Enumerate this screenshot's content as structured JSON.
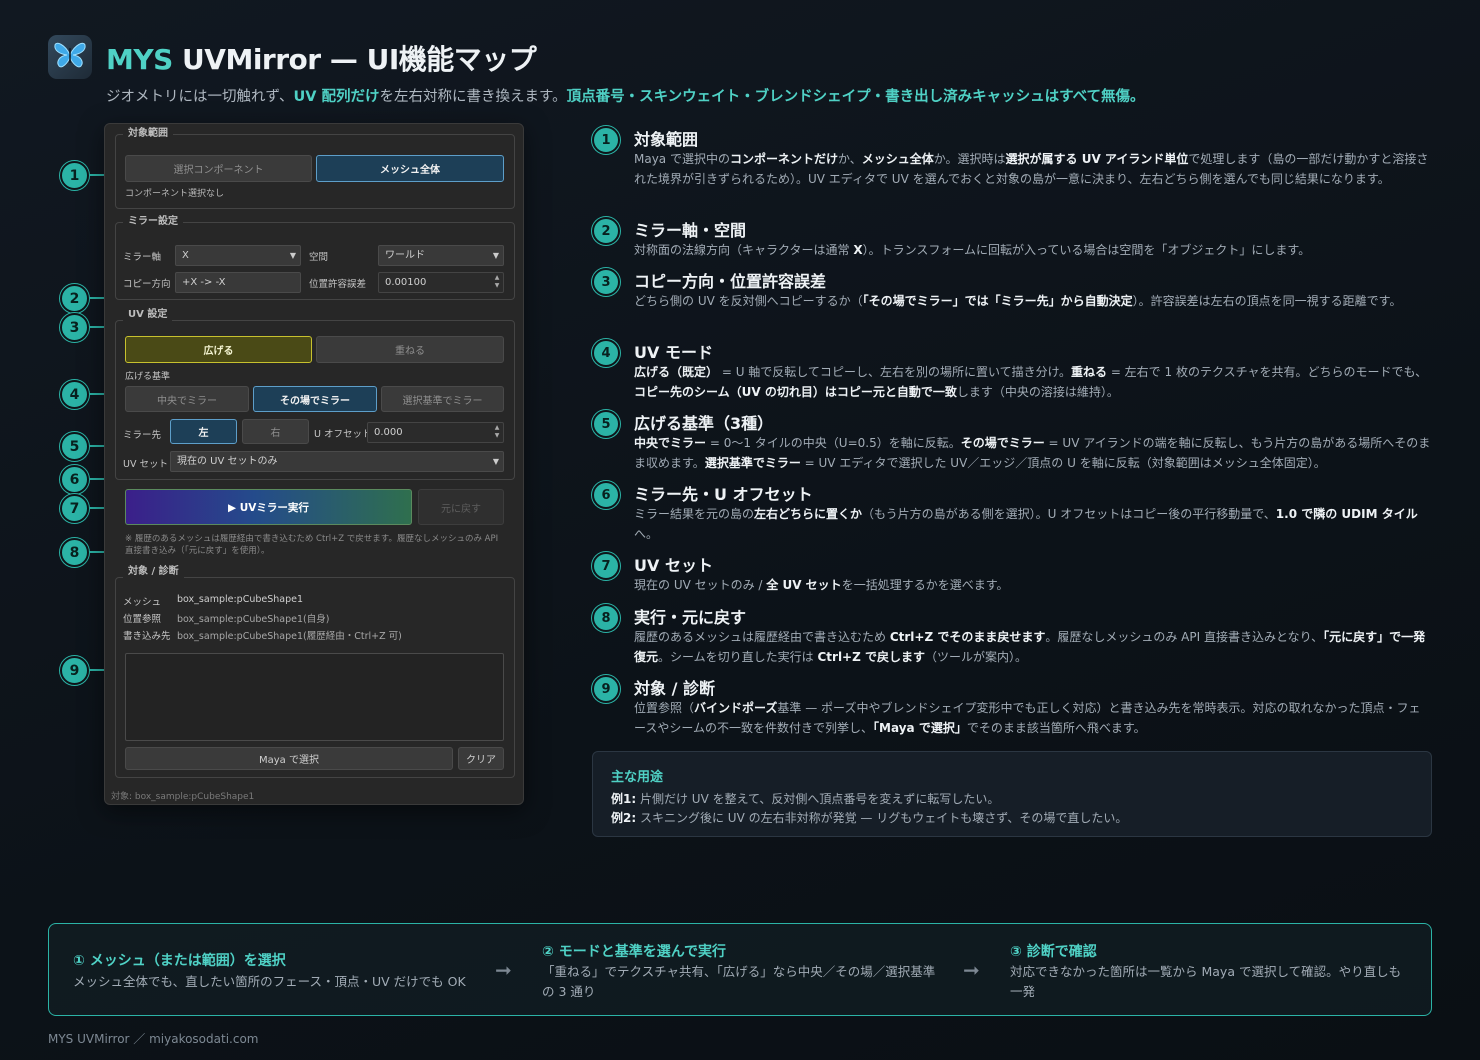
{
  "header": {
    "title_brand": "MYS",
    "title_rest": " UVMirror — UI機能マップ",
    "logo_icon": "butterfly-icon",
    "subtitle_a": "ジオメトリには一切触れず、",
    "subtitle_b": "UV 配列だけ",
    "subtitle_c": "を左右対称に書き換えます。",
    "subtitle_d": "頂点番号・スキンウェイト・ブレンドシェイプ・書き出し済みキャッシュはすべて無傷。"
  },
  "panel": {
    "scope": {
      "group": "対象範囲",
      "btn_components": "選択コンポーネント",
      "btn_mesh": "メッシュ全体",
      "status": "コンポーネント選択なし"
    },
    "mirror": {
      "group": "ミラー設定",
      "axis_label": "ミラー軸",
      "axis_value": "X",
      "space_label": "空間",
      "space_value": "ワールド",
      "dir_label": "コピー方向",
      "dir_value": "+X -> -X",
      "tol_label": "位置許容誤差",
      "tol_value": "0.00100"
    },
    "uv": {
      "group": "UV 設定",
      "btn_spread": "広げる",
      "btn_overlap": "重ねる",
      "basis_label": "広げる基準",
      "basis_center": "中央でミラー",
      "basis_inplace": "その場でミラー",
      "basis_selection": "選択基準でミラー",
      "dest_label": "ミラー先",
      "dest_left": "左",
      "dest_right": "右",
      "uoffset_label": "U オフセット",
      "uoffset_value": "0.000",
      "uvset_label": "UV セット",
      "uvset_value": "現在の UV セットのみ"
    },
    "run_label": "▶ UVミラー実行",
    "undo_label": "元に戻す",
    "note": "※ 履歴のあるメッシュは履歴経由で書き込むため Ctrl+Z で戻せます。履歴なしメッシュのみ API 直接書き込み（「元に戻す」を使用）。",
    "diag": {
      "group": "対象 / 診断",
      "mesh_label": "メッシュ",
      "mesh_value": "box_sample:pCubeShape1",
      "ref_label": "位置参照",
      "ref_value": "box_sample:pCubeShape1(自身)",
      "write_label": "書き込み先",
      "write_value": "box_sample:pCubeShape1(履歴経由・Ctrl+Z 可)",
      "select_btn": "Maya で選択",
      "clear_btn": "クリア"
    },
    "status_bar": "対象: box_sample:pCubeShape1"
  },
  "callouts": [
    "1",
    "2",
    "3",
    "4",
    "5",
    "6",
    "7",
    "8",
    "9"
  ],
  "items": [
    {
      "num": "1",
      "title": "対象範囲"
    },
    {
      "num": "2",
      "title": "ミラー軸・空間"
    },
    {
      "num": "3",
      "title": "コピー方向・位置許容誤差"
    },
    {
      "num": "4",
      "title": "UV モード"
    },
    {
      "num": "5",
      "title": "広げる基準（3種）"
    },
    {
      "num": "6",
      "title": "ミラー先・U オフセット"
    },
    {
      "num": "7",
      "title": "UV セット"
    },
    {
      "num": "8",
      "title": "実行・元に戻す"
    },
    {
      "num": "9",
      "title": "対象 / 診断"
    }
  ],
  "descs": {
    "d1": [
      "Maya で選択中の",
      "コンポーネントだけ",
      "か、",
      "メッシュ全体",
      "か。選択時は",
      "選択が属する UV アイランド単位",
      "で処理します（島の一部だけ動かすと溶接された境界が引きずられるため）。UV エディタで UV を選んでおくと対象の島が一意に決まり、左右どちら側を選んでも同じ結果になります。"
    ],
    "d2": [
      "対称面の法線方向（キャラクターは通常 ",
      "X",
      "）。トランスフォームに回転が入っている場合は空間を「オブジェクト」にします。"
    ],
    "d3": [
      "どちら側の UV を反対側へコピーするか（",
      "「その場でミラー」では「ミラー先」から自動決定",
      "）。許容誤差は左右の頂点を同一視する距離です。"
    ],
    "d4": [
      "広げる（既定）",
      " = U 軸で反転してコピーし、左右を別の場所に置いて描き分け。",
      "重ねる",
      " = 左右で 1 枚のテクスチャを共有。どちらのモードでも、",
      "コピー先のシーム（UV の切れ目）はコピー元と自動で一致",
      "します（中央の溶接は維持）。"
    ],
    "d5": [
      "中央でミラー",
      " = 0〜1 タイルの中央（U=0.5）を軸に反転。",
      "その場でミラー",
      " = UV アイランドの端を軸に反転し、もう片方の島がある場所へそのまま収めます。",
      "選択基準でミラー",
      " = UV エディタで選択した UV／エッジ／頂点の U を軸に反転（対象範囲はメッシュ全体固定）。"
    ],
    "d6": [
      "ミラー結果を元の島の",
      "左右どちらに置くか",
      "（もう片方の島がある側を選択）。U オフセットはコピー後の平行移動量で、",
      "1.0 で隣の UDIM タイル",
      "へ。"
    ],
    "d7": [
      "現在の UV セットのみ / ",
      "全 UV セット",
      "を一括処理するかを選べます。"
    ],
    "d8": [
      "履歴のあるメッシュは履歴経由で書き込むため ",
      "Ctrl+Z でそのまま戻せます",
      "。履歴なしメッシュのみ API 直接書き込みとなり、",
      "「元に戻す」で一発復元",
      "。シームを切り直した実行は ",
      "Ctrl+Z で戻します",
      "（ツールが案内）。"
    ],
    "d9": [
      "位置参照（",
      "バインドポーズ",
      "基準 — ポーズ中やブレンドシェイプ変形中でも正しく対応）と書き込み先を常時表示。対応の取れなかった頂点・フェースやシームの不一致を件数付きで列挙し、",
      "「Maya で選択」",
      "でそのまま該当箇所へ飛べます。"
    ]
  },
  "uses": {
    "title": "主な用途",
    "ex1_label": "例1:",
    "ex1": " 片側だけ UV を整えて、反対側へ頂点番号を変えずに転写したい。",
    "ex2_label": "例2:",
    "ex2": " スキニング後に UV の左右非対称が発覚 — リグもウェイトも壊さず、その場で直したい。"
  },
  "steps": [
    {
      "title": "① メッシュ（または範囲）を選択",
      "desc": "メッシュ全体でも、直したい箇所のフェース・頂点・UV だけでも OK"
    },
    {
      "title": "② モードと基準を選んで実行",
      "desc": "「重ねる」でテクスチャ共有、「広げる」なら中央／その場／選択基準の 3 通り"
    },
    {
      "title": "③ 診断で確認",
      "desc": "対応できなかった箇所は一覧から Maya で選択して確認。やり直しも一発"
    }
  ],
  "arrow": "➞",
  "footer": "MYS UVMirror ／ miyakosodati.com",
  "colors": {
    "accent": "#4fd1c5",
    "badge": "#2bb3a6",
    "bg": "#0e141a",
    "panel": "#272727"
  }
}
